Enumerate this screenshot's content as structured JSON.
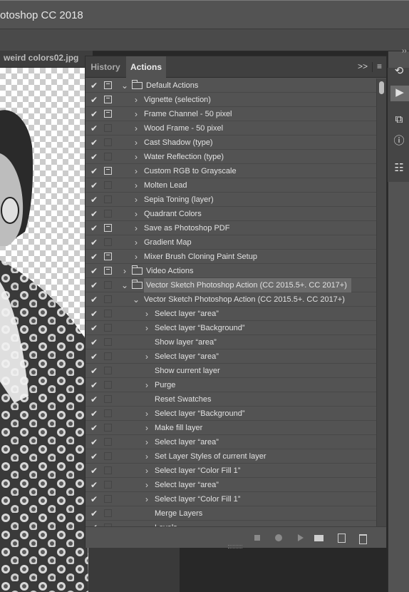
{
  "window": {
    "title": "otoshop CC 2018"
  },
  "document": {
    "tab_title": "weird colors02.jpg"
  },
  "panel": {
    "tabs": [
      "History",
      "Actions"
    ],
    "active_tab": "Actions",
    "menu_icons": {
      "collapse": ">>",
      "menu": "≡"
    }
  },
  "actions": [
    {
      "label": "Default Actions",
      "level": 0,
      "type": "set",
      "expanded": true,
      "checked": true,
      "dialog": true,
      "selected": false
    },
    {
      "label": "Vignette (selection)",
      "level": 1,
      "type": "action",
      "expandable": true,
      "checked": true,
      "dialog": true
    },
    {
      "label": "Frame Channel - 50 pixel",
      "level": 1,
      "type": "action",
      "expandable": true,
      "checked": true,
      "dialog": true
    },
    {
      "label": "Wood Frame - 50 pixel",
      "level": 1,
      "type": "action",
      "expandable": true,
      "checked": true,
      "dialog": false
    },
    {
      "label": "Cast Shadow (type)",
      "level": 1,
      "type": "action",
      "expandable": true,
      "checked": true,
      "dialog": false
    },
    {
      "label": "Water Reflection (type)",
      "level": 1,
      "type": "action",
      "expandable": true,
      "checked": true,
      "dialog": false
    },
    {
      "label": "Custom RGB to Grayscale",
      "level": 1,
      "type": "action",
      "expandable": true,
      "checked": true,
      "dialog": true
    },
    {
      "label": "Molten Lead",
      "level": 1,
      "type": "action",
      "expandable": true,
      "checked": true,
      "dialog": false
    },
    {
      "label": "Sepia Toning (layer)",
      "level": 1,
      "type": "action",
      "expandable": true,
      "checked": true,
      "dialog": false
    },
    {
      "label": "Quadrant Colors",
      "level": 1,
      "type": "action",
      "expandable": true,
      "checked": true,
      "dialog": false
    },
    {
      "label": "Save as Photoshop PDF",
      "level": 1,
      "type": "action",
      "expandable": true,
      "checked": true,
      "dialog": true
    },
    {
      "label": "Gradient Map",
      "level": 1,
      "type": "action",
      "expandable": true,
      "checked": true,
      "dialog": false
    },
    {
      "label": "Mixer Brush Cloning Paint Setup",
      "level": 1,
      "type": "action",
      "expandable": true,
      "checked": true,
      "dialog": true
    },
    {
      "label": "Video Actions",
      "level": 0,
      "type": "set",
      "expanded": false,
      "checked": true,
      "dialog": true,
      "selected": false
    },
    {
      "label": "Vector Sketch Photoshop Action (CC 2015.5+. CC 2017+)",
      "level": 0,
      "type": "set",
      "expanded": true,
      "checked": true,
      "dialog": false,
      "selected": true
    },
    {
      "label": "Vector Sketch Photoshop Action (CC 2015.5+. CC 2017+)",
      "level": 1,
      "type": "action",
      "expandable": true,
      "expanded": true,
      "checked": true,
      "dialog": false
    },
    {
      "label": "Select layer “area”",
      "level": 2,
      "type": "step",
      "expandable": true,
      "checked": true,
      "dialog": false
    },
    {
      "label": "Select layer “Background”",
      "level": 2,
      "type": "step",
      "expandable": true,
      "checked": true,
      "dialog": false
    },
    {
      "label": "Show layer “area”",
      "level": 2,
      "type": "step",
      "expandable": false,
      "checked": true,
      "dialog": false
    },
    {
      "label": "Select layer “area”",
      "level": 2,
      "type": "step",
      "expandable": true,
      "checked": true,
      "dialog": false
    },
    {
      "label": "Show current layer",
      "level": 2,
      "type": "step",
      "expandable": false,
      "checked": true,
      "dialog": false
    },
    {
      "label": "Purge",
      "level": 2,
      "type": "step",
      "expandable": true,
      "checked": true,
      "dialog": false
    },
    {
      "label": "Reset Swatches",
      "level": 2,
      "type": "step",
      "expandable": false,
      "checked": true,
      "dialog": false
    },
    {
      "label": "Select layer “Background”",
      "level": 2,
      "type": "step",
      "expandable": true,
      "checked": true,
      "dialog": false
    },
    {
      "label": "Make fill layer",
      "level": 2,
      "type": "step",
      "expandable": true,
      "checked": true,
      "dialog": false
    },
    {
      "label": "Select layer “area”",
      "level": 2,
      "type": "step",
      "expandable": true,
      "checked": true,
      "dialog": false
    },
    {
      "label": "Set Layer Styles of current layer",
      "level": 2,
      "type": "step",
      "expandable": true,
      "checked": true,
      "dialog": false
    },
    {
      "label": "Select layer “Color Fill 1”",
      "level": 2,
      "type": "step",
      "expandable": true,
      "checked": true,
      "dialog": false
    },
    {
      "label": "Select layer “area”",
      "level": 2,
      "type": "step",
      "expandable": true,
      "checked": true,
      "dialog": false
    },
    {
      "label": "Select layer “Color Fill 1”",
      "level": 2,
      "type": "step",
      "expandable": true,
      "checked": true,
      "dialog": false
    },
    {
      "label": "Merge Layers",
      "level": 2,
      "type": "step",
      "expandable": false,
      "checked": true,
      "dialog": false
    },
    {
      "label": "Levels",
      "level": 2,
      "type": "step",
      "expandable": true,
      "checked": true,
      "dialog": false
    }
  ],
  "bottom_buttons": [
    {
      "name": "stop-recording-button",
      "icon": "stop-icon",
      "cls": "stop"
    },
    {
      "name": "begin-recording-button",
      "icon": "record-icon",
      "cls": "rec"
    },
    {
      "name": "play-selection-button",
      "icon": "play-icon",
      "cls": "play"
    },
    {
      "name": "create-new-set-button",
      "icon": "folder-icon",
      "cls": "fold"
    },
    {
      "name": "create-new-action-button",
      "icon": "new-action-icon",
      "cls": "newac"
    },
    {
      "name": "delete-button",
      "icon": "trash-icon",
      "cls": "trash"
    }
  ],
  "right_dock": [
    {
      "name": "history-panel-icon",
      "glyph": "⟲",
      "active": false
    },
    {
      "name": "actions-panel-icon",
      "glyph": "▶",
      "active": true
    },
    {
      "name": "libraries-panel-icon",
      "glyph": "⧉",
      "active": false
    },
    {
      "name": "info-panel-icon",
      "glyph": "ⓘ",
      "active": false
    },
    {
      "name": "properties-panel-icon",
      "glyph": "☷",
      "active": false
    }
  ],
  "colors": {
    "panel": "#535353",
    "selected_row": "#6b6b6b",
    "text": "#e2e2e2"
  }
}
